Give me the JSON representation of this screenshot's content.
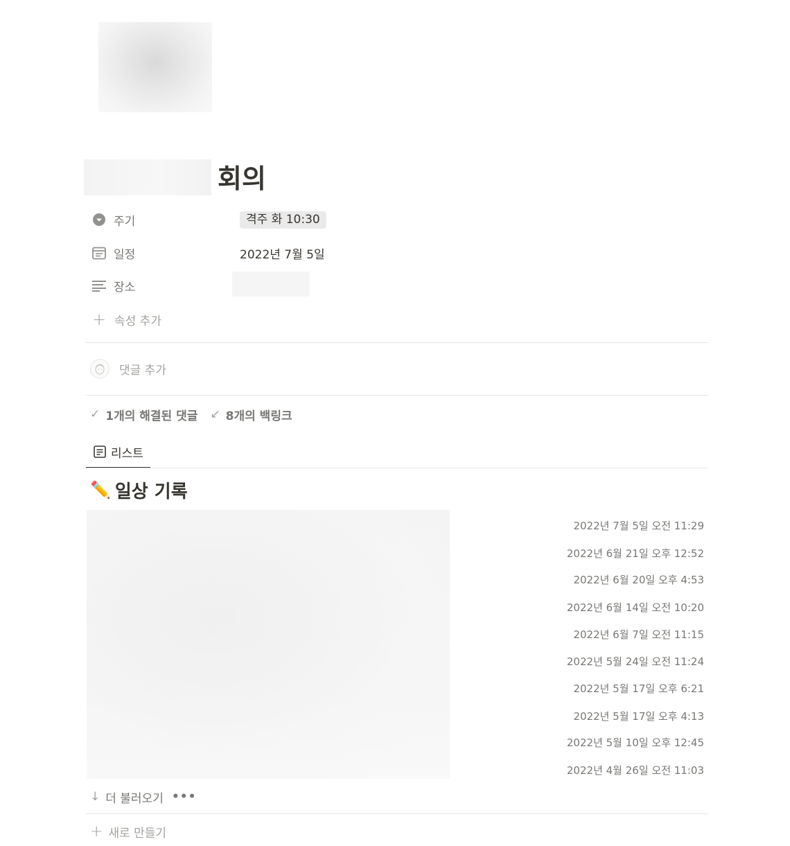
{
  "page": {
    "title": "회의"
  },
  "properties": [
    {
      "name": "주기",
      "icon": "select-icon",
      "value": "격주 화 10:30"
    },
    {
      "name": "일정",
      "icon": "calendar-icon",
      "value": "2022년 7월 5일"
    },
    {
      "name": "장소",
      "icon": "text-lines-icon",
      "value": ""
    }
  ],
  "add_property_label": "속성 추가",
  "comment": {
    "placeholder": "댓글 추가"
  },
  "meta": {
    "resolved_comments": "1개의 해결된 댓글",
    "backlinks": "8개의 백링크"
  },
  "tabs": [
    {
      "label": "리스트",
      "icon": "list-view-icon",
      "active": true
    }
  ],
  "database": {
    "emoji": "✏️",
    "title": "일상 기록",
    "items": [
      {
        "date": "2022년 7월 5일 오전 11:29"
      },
      {
        "date": "2022년 6월 21일 오후 12:52"
      },
      {
        "date": "2022년 6월 20일 오후 4:53"
      },
      {
        "date": "2022년 6월 14일 오전 10:20"
      },
      {
        "date": "2022년 6월 7일 오전 11:15"
      },
      {
        "date": "2022년 5월 24일 오전 11:24"
      },
      {
        "date": "2022년 5월 17일 오후 6:21"
      },
      {
        "date": "2022년 5월 17일 오후 4:13"
      },
      {
        "date": "2022년 5월 10일 오후 12:45"
      },
      {
        "date": "2022년 4월 26일 오전 11:03"
      }
    ],
    "load_more_label": "더 불러오기",
    "more_icon": "ellipsis-icon",
    "new_label": "새로 만들기"
  },
  "colors": {
    "text": "#37352f",
    "muted": "#787774",
    "light": "#a3a29e",
    "divider": "#e6e6e4",
    "tag_bg": "#ebeaea"
  }
}
